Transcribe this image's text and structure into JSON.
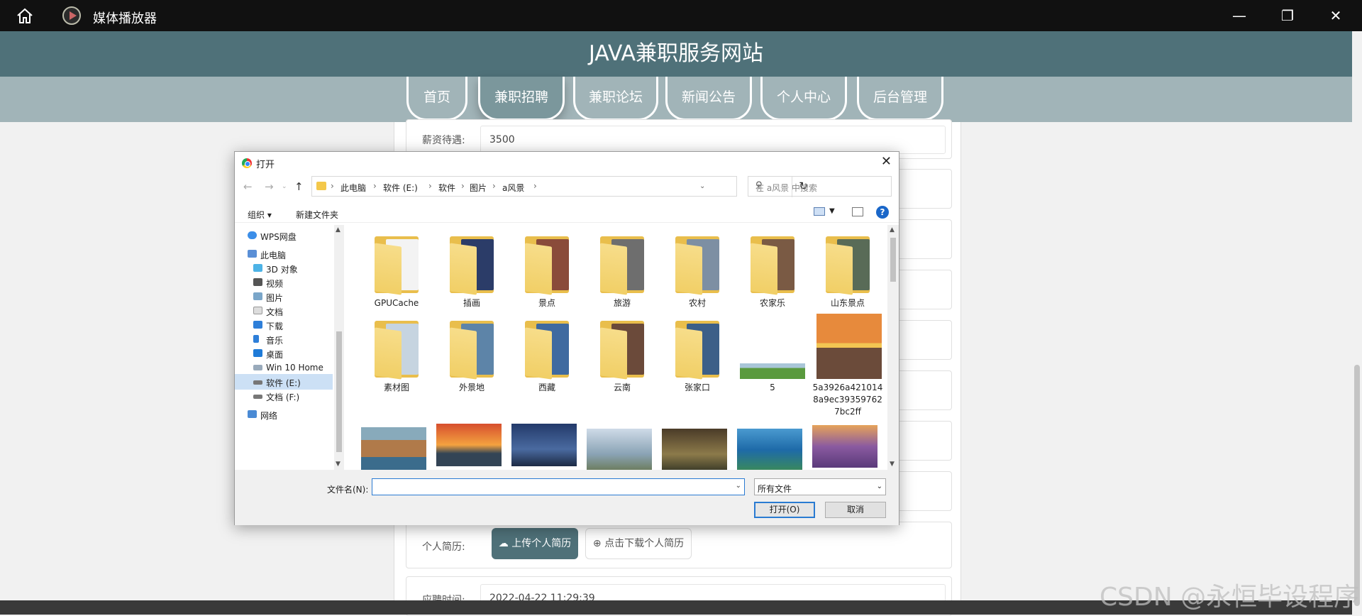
{
  "player": {
    "title": "媒体播放器",
    "minimize": "—",
    "restore": "❐",
    "close": "✕"
  },
  "site": {
    "title": "JAVA兼职服务网站",
    "nav": [
      "首页",
      "兼职招聘",
      "兼职论坛",
      "新闻公告",
      "个人中心",
      "后台管理"
    ],
    "active_tab": "兼职招聘"
  },
  "form": {
    "salary_label": "薪资待遇:",
    "salary_value": "3500",
    "resume_label": "个人简历:",
    "upload_label": "上传个人简历",
    "download_label": "点击下载个人简历",
    "time_label": "应聘时间:",
    "time_value": "2022-04-22 11:29:39"
  },
  "dialog": {
    "title": "打开",
    "breadcrumb": [
      "此电脑",
      "软件 (E:)",
      "软件",
      "图片",
      "a风景"
    ],
    "search_placeholder": "在 a风景 中搜索",
    "organize": "组织 ▾",
    "new_folder": "新建文件夹",
    "nav_items": [
      {
        "label": "WPS网盘",
        "icon": "cloud-icon"
      },
      {
        "label": "此电脑",
        "icon": "computer-icon"
      },
      {
        "label": "3D 对象",
        "icon": "cube-icon"
      },
      {
        "label": "视频",
        "icon": "video-icon"
      },
      {
        "label": "图片",
        "icon": "picture-icon"
      },
      {
        "label": "文档",
        "icon": "document-icon"
      },
      {
        "label": "下载",
        "icon": "download-icon"
      },
      {
        "label": "音乐",
        "icon": "music-icon"
      },
      {
        "label": "桌面",
        "icon": "desktop-icon"
      },
      {
        "label": "Win 10 Home",
        "icon": "drive-icon"
      },
      {
        "label": "软件 (E:)",
        "icon": "drive-icon"
      },
      {
        "label": "文档 (F:)",
        "icon": "drive-icon"
      },
      {
        "label": "网络",
        "icon": "network-icon"
      }
    ],
    "files": [
      {
        "name": "GPUCache",
        "kind": "folder",
        "color": "#f3f3f3"
      },
      {
        "name": "插画",
        "kind": "folder",
        "color": "#2b3c68"
      },
      {
        "name": "景点",
        "kind": "folder",
        "color": "#8a4b3a"
      },
      {
        "name": "旅游",
        "kind": "folder",
        "color": "#6e6e6e"
      },
      {
        "name": "农村",
        "kind": "folder",
        "color": "#7d8fa3"
      },
      {
        "name": "农家乐",
        "kind": "folder",
        "color": "#7a5a44"
      },
      {
        "name": "山东景点",
        "kind": "folder",
        "color": "#596b57"
      },
      {
        "name": "素材图",
        "kind": "folder",
        "color": "#c6d4e0"
      },
      {
        "name": "外景地",
        "kind": "folder",
        "color": "#5d84a8"
      },
      {
        "name": "西藏",
        "kind": "folder",
        "color": "#3f6aa0"
      },
      {
        "name": "云南",
        "kind": "folder",
        "color": "#6b4a3a"
      },
      {
        "name": "张家口",
        "kind": "folder",
        "color": "#3c5f88"
      },
      {
        "name": "5",
        "kind": "image",
        "color": "#4a8f3a"
      },
      {
        "name": "5a3926a4210148a9ec393597627bc2ff",
        "kind": "image",
        "color": "#d9743a"
      }
    ],
    "filename_label": "文件名(N):",
    "filename_value": "",
    "filetype": "所有文件",
    "open_button": "打开(O)",
    "cancel_button": "取消"
  },
  "watermark": "CSDN @永恒毕设程序"
}
